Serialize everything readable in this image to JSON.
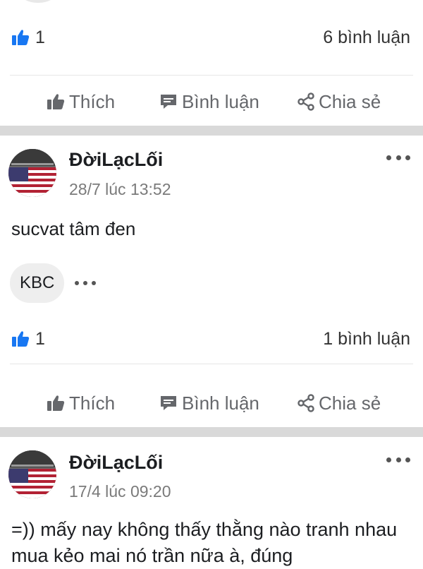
{
  "colors": {
    "like_blue": "#1877f2",
    "action_grey": "#65676b",
    "divider": "#d9d9d9"
  },
  "top_stats": {
    "like_count": "1",
    "comment_count": "6 bình luận"
  },
  "actions": {
    "like_label": "Thích",
    "comment_label": "Bình luận",
    "share_label": "Chia sẻ"
  },
  "post1": {
    "author": "ĐờiLạcLối",
    "timestamp": "28/7 lúc 13:52",
    "text": "sucvat tâm đen",
    "tag": "KBC",
    "like_count": "1",
    "comment_count": "1 bình luận"
  },
  "post2": {
    "author": "ĐờiLạcLối",
    "timestamp": "17/4 lúc 09:20",
    "text": "=)) mấy nay không thấy thằng nào tranh nhau mua kẻo mai nó trần nữa à, đúng"
  },
  "icons": {
    "like": "thumbs-up-icon",
    "comment": "comment-bubble-icon",
    "share": "share-icon",
    "more": "more-dots-icon",
    "avatar": "us-flag-avatar"
  }
}
